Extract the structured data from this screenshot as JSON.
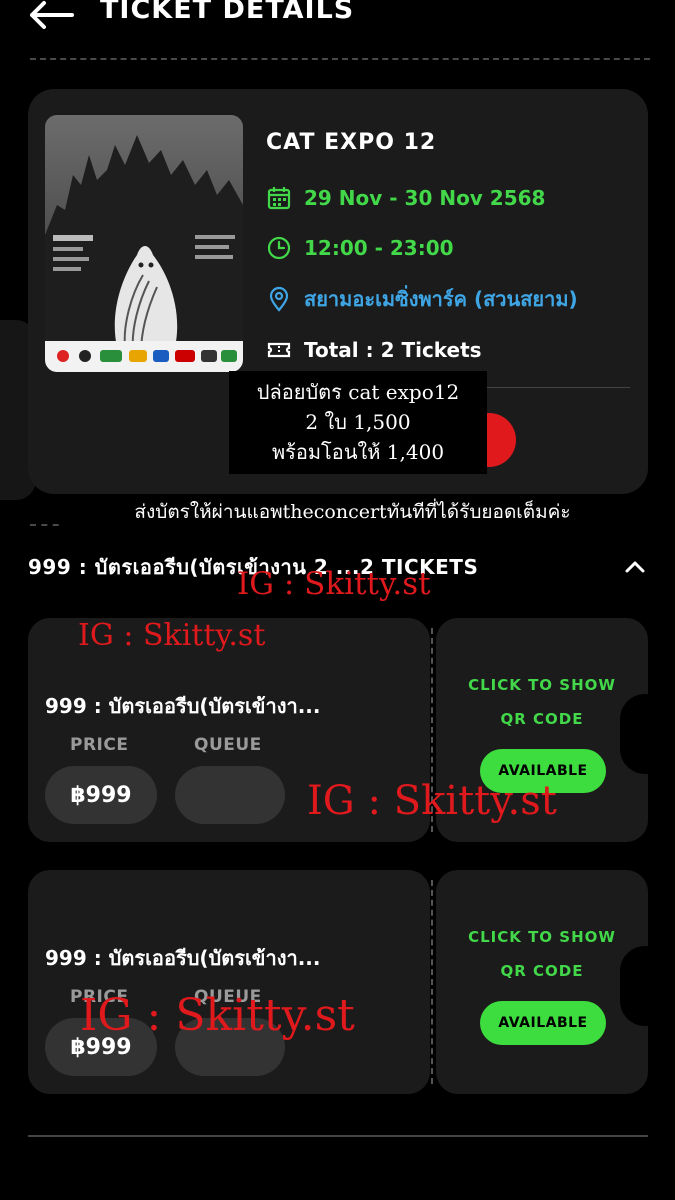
{
  "header": {
    "title": "TICKET DETAILS",
    "back_icon": "arrow-left-icon"
  },
  "event": {
    "title": "CAT EXPO 12",
    "date": "29 Nov - 30 Nov 2568",
    "time": "12:00 - 23:00",
    "venue": "สยามอะเมซิ่งพาร์ค (สวนสยาม)",
    "total": "Total : 2 Tickets",
    "icons": [
      "calendar-icon",
      "clock-icon",
      "location-pin-icon",
      "ticket-icon"
    ]
  },
  "overlay": {
    "line1": "ปล่อยบัตร cat expo12",
    "line2": "2 ใบ 1,500",
    "line3": "พร้อมโอนให้ 1,400",
    "line4": "ส่งบัตรให้ผ่านแอพtheconcertทันทีที่ได้รับยอดเต็มค่ะ"
  },
  "section": {
    "label": "999 : บัตรเออรีบ(บัตรเข้างาน 2 ...2 TICKETS"
  },
  "tickets": [
    {
      "name": "999 : บัตรเออรีบ(บัตรเข้างา...",
      "price_label": "PRICE",
      "queue_label": "QUEUE",
      "price": "฿999",
      "queue": "",
      "cta_line1": "CLICK TO SHOW",
      "cta_line2": "QR CODE",
      "status": "AVAILABLE"
    },
    {
      "name": "999 : บัตรเออรีบ(บัตรเข้างา...",
      "price_label": "PRICE",
      "queue_label": "QUEUE",
      "price": "฿999",
      "queue": "",
      "cta_line1": "CLICK TO SHOW",
      "cta_line2": "QR CODE",
      "status": "AVAILABLE"
    }
  ],
  "watermarks": [
    "IG : Skitty.st",
    "IG : Skitty.st",
    "IG : Skitty.st",
    "IG : Skitty.st"
  ],
  "colors": {
    "accent_green": "#42d84a",
    "venue_blue": "#3fa6e6",
    "watermark_red": "#e0191d",
    "card_bg": "#1b1b1b"
  }
}
